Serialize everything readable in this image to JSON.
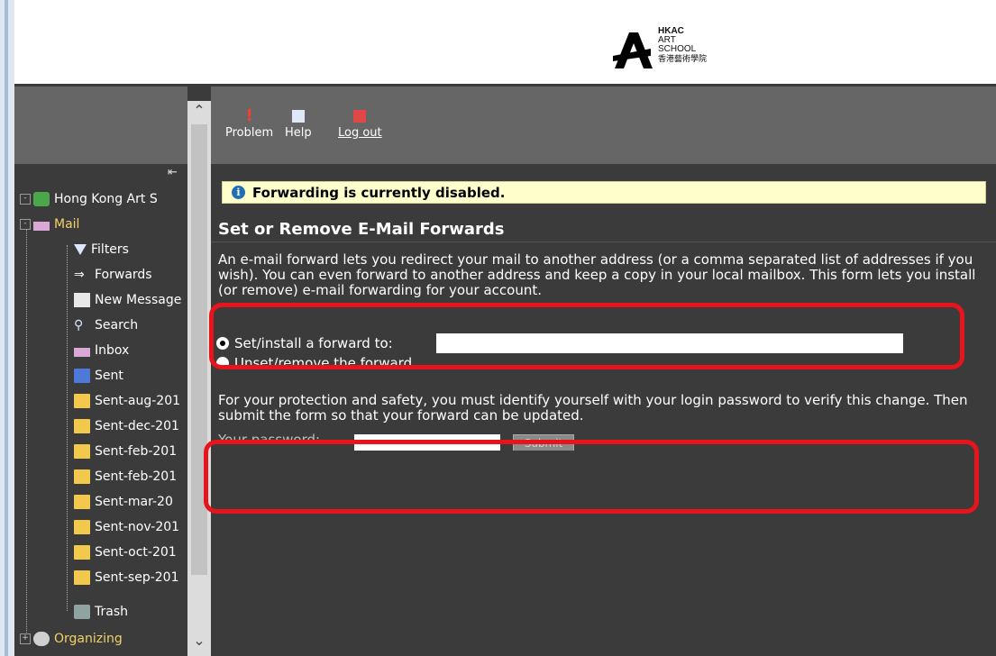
{
  "logo": {
    "line1": "HKAC",
    "line2": "ART",
    "line3": "SCHOOL",
    "line4": "香港藝術學院"
  },
  "toolbar": {
    "problem_label": "Problem",
    "help_label": "Help",
    "logout_label": "Log out"
  },
  "sidebar": {
    "root_label": "Hong Kong Art S",
    "mail_label": "Mail",
    "items": [
      {
        "label": "Filters",
        "icon": "filter-icon"
      },
      {
        "label": "Forwards",
        "icon": "arrow-right-icon"
      },
      {
        "label": "New Message",
        "icon": "compose-icon"
      },
      {
        "label": "Search",
        "icon": "search-icon"
      },
      {
        "label": "Inbox",
        "icon": "envelope-icon"
      },
      {
        "label": "Sent",
        "icon": "sent-icon"
      },
      {
        "label": "Sent-aug-201",
        "icon": "folder-icon"
      },
      {
        "label": "Sent-dec-201",
        "icon": "folder-icon"
      },
      {
        "label": "Sent-feb-201",
        "icon": "folder-icon"
      },
      {
        "label": "Sent-feb-201",
        "icon": "folder-icon"
      },
      {
        "label": "Sent-mar-20",
        "icon": "folder-icon"
      },
      {
        "label": "Sent-nov-201",
        "icon": "folder-icon"
      },
      {
        "label": "Sent-oct-201",
        "icon": "folder-icon"
      },
      {
        "label": "Sent-sep-201",
        "icon": "folder-icon"
      },
      {
        "label": "Trash",
        "icon": "trash-icon"
      }
    ],
    "organizing_label": "Organizing"
  },
  "notice": {
    "text": "Forwarding is currently disabled."
  },
  "section": {
    "title": "Set or Remove E-Mail Forwards",
    "description": "An e-mail forward lets you redirect your mail to another address (or a comma separated list of addresses if you wish). You can even forward to another address and keep a copy in your local mailbox. This form lets you install (or remove) e-mail forwarding for your account.",
    "set_label": "Set/install a forward to:",
    "set_value": "",
    "unset_label": "Unset/remove the forward",
    "protection_text": "For your protection and safety, you must identify yourself with your login password to verify this change.  Then submit the form so that your forward can be updated.",
    "password_label": "Your password:",
    "password_value": "",
    "submit_label": "Submit"
  },
  "colors": {
    "highlight": "#e8141c",
    "notice_bg": "#ffffcc",
    "panel_bg": "#3b3b3b",
    "toolbar_bg": "#666666"
  }
}
